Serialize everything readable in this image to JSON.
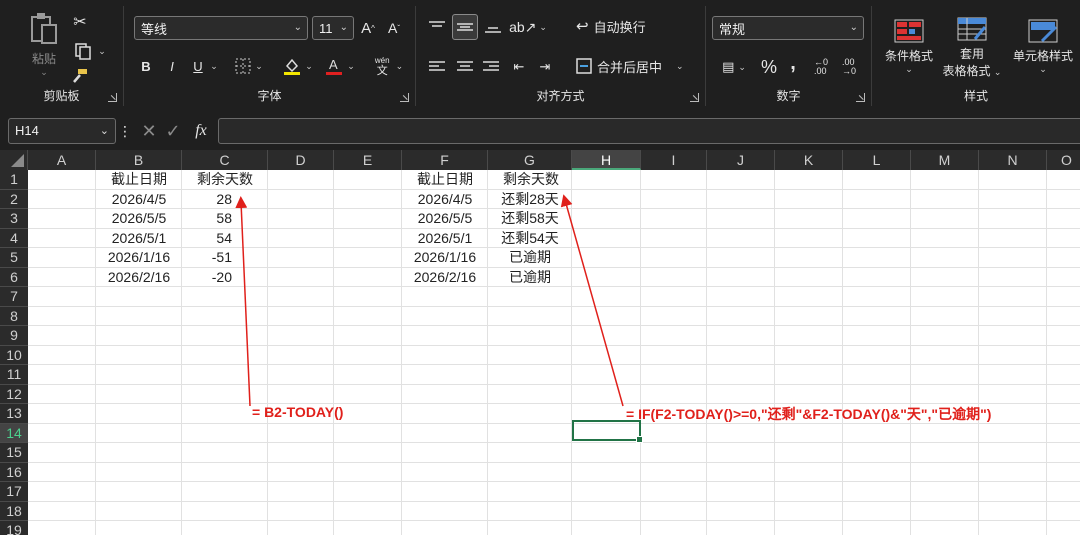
{
  "ribbon": {
    "clipboard": {
      "label": "剪贴板",
      "paste_label": "粘贴"
    },
    "font": {
      "label": "字体",
      "family": "等线",
      "size": "11",
      "bold": "B",
      "italic": "I",
      "underline": "U",
      "phonetic_top": "wén",
      "phonetic_bottom": "文"
    },
    "alignment": {
      "label": "对齐方式",
      "wrap_text": "自动换行",
      "merge_center": "合并后居中"
    },
    "number": {
      "label": "数字",
      "format": "常规",
      "percent": "%",
      "comma": ","
    },
    "styles": {
      "label": "样式",
      "conditional": "条件格式",
      "table_line1": "套用",
      "table_line2": "表格格式",
      "cell_styles": "单元格样式"
    }
  },
  "formula_bar": {
    "name_box": "H14",
    "fx": "fx",
    "formula": ""
  },
  "columns": [
    "A",
    "B",
    "C",
    "D",
    "E",
    "F",
    "G",
    "H",
    "I",
    "J",
    "K",
    "L",
    "M",
    "N",
    "O"
  ],
  "rows": [
    "1",
    "2",
    "3",
    "4",
    "5",
    "6",
    "7",
    "8",
    "9",
    "10",
    "11",
    "12",
    "13",
    "14",
    "15",
    "16",
    "17",
    "18",
    "19"
  ],
  "selected": {
    "column": "H",
    "row": "14"
  },
  "table1": {
    "headers": [
      "截止日期",
      "剩余天数"
    ],
    "dates": [
      "2026/4/5",
      "2026/5/5",
      "2026/5/1",
      "2026/1/16",
      "2026/2/16"
    ],
    "days": [
      "28",
      "58",
      "54",
      "-51",
      "-20"
    ]
  },
  "table2": {
    "headers": [
      "截止日期",
      "剩余天数"
    ],
    "dates": [
      "2026/4/5",
      "2026/5/5",
      "2026/5/1",
      "2026/1/16",
      "2026/2/16"
    ],
    "results": [
      "还剩28天",
      "还剩58天",
      "还剩54天",
      "已逾期",
      "已逾期"
    ]
  },
  "annotations": {
    "formula1": "= B2-TODAY()",
    "formula2": "= IF(F2-TODAY()>=0,\"还剩\"&F2-TODAY()&\"天\",\"已逾期\")"
  },
  "colors": {
    "annotation": "#e0201b",
    "selection": "#217346"
  }
}
